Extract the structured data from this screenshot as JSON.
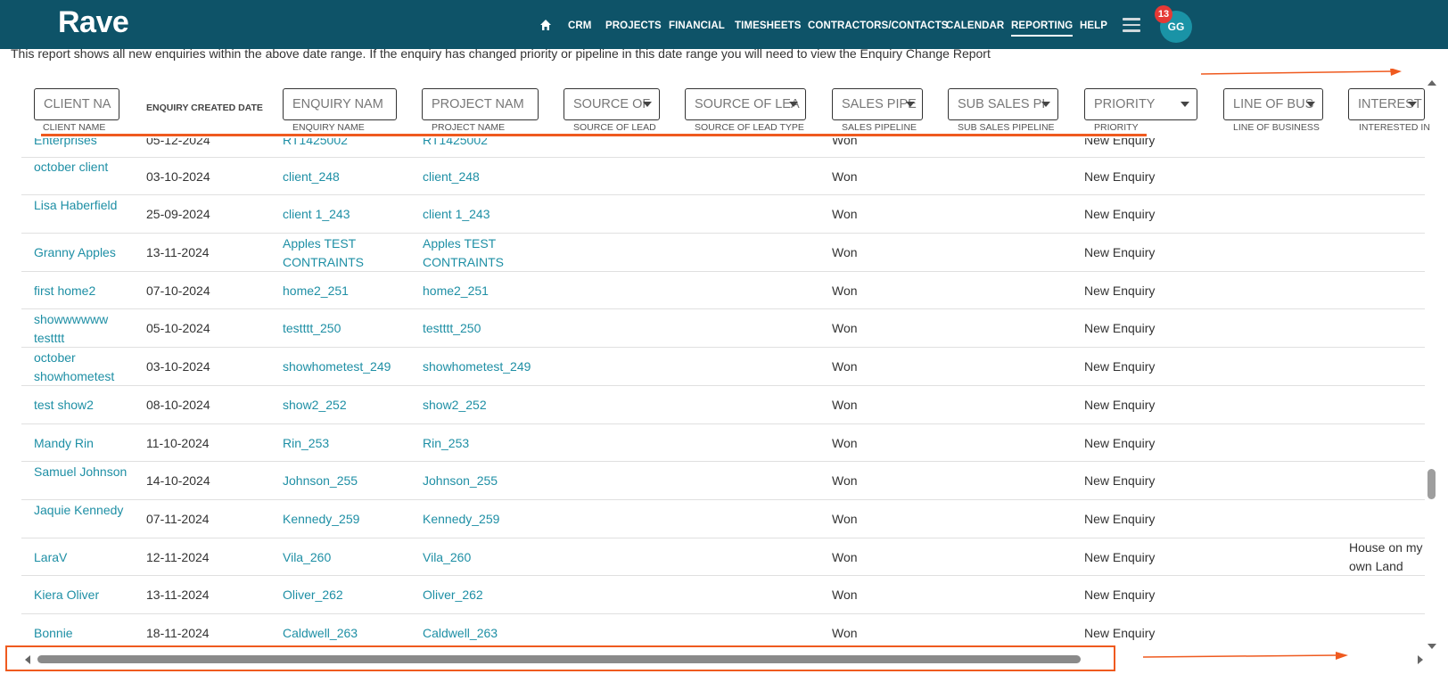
{
  "app": {
    "logo": "Rave"
  },
  "nav": {
    "items": [
      "CRM",
      "PROJECTS",
      "FINANCIAL",
      "TIMESHEETS",
      "CONTRACTORS/CONTACTS",
      "CALENDAR",
      "REPORTING",
      "HELP"
    ],
    "active": "REPORTING",
    "notification_count": "13",
    "avatar_initials": "GG"
  },
  "note": "This report shows all new enquiries within the above date range. If the enquiry has changed priority or pipeline in this date range you will need to view the Enquiry Change Report",
  "filters": [
    {
      "placeholder": "CLIENT NA",
      "label": "CLIENT NAME",
      "dropdown": false
    },
    {
      "placeholder": "ENQUIRY NAM",
      "label": "ENQUIRY NAME",
      "dropdown": false
    },
    {
      "placeholder": "PROJECT NAM",
      "label": "PROJECT NAME",
      "dropdown": false
    },
    {
      "placeholder": "SOURCE OF",
      "label": "SOURCE OF LEAD",
      "dropdown": true
    },
    {
      "placeholder": "SOURCE OF LEA",
      "label": "SOURCE OF LEAD TYPE",
      "dropdown": true
    },
    {
      "placeholder": "SALES PIPE",
      "label": "SALES PIPELINE",
      "dropdown": true
    },
    {
      "placeholder": "SUB SALES PI",
      "label": "SUB SALES PIPELINE",
      "dropdown": true
    },
    {
      "placeholder": "PRIORITY",
      "label": "PRIORITY",
      "dropdown": true
    },
    {
      "placeholder": "LINE OF BUS",
      "label": "LINE OF BUSINESS",
      "dropdown": true
    },
    {
      "placeholder": "INTEREST",
      "label": "INTERESTED IN",
      "dropdown": true
    }
  ],
  "created_date_header": "ENQUIRY CREATED DATE",
  "rows": [
    {
      "client": "Enterprises",
      "date": "05-12-2024",
      "enquiry": "RT1425002",
      "project": "RT1425002",
      "pipeline": "Won",
      "priority": "New Enquiry",
      "interest": ""
    },
    {
      "client": "october client",
      "date": "03-10-2024",
      "enquiry": "client_248",
      "project": "client_248",
      "pipeline": "Won",
      "priority": "New Enquiry",
      "interest": ""
    },
    {
      "client": "Lisa Haberfield",
      "date": "25-09-2024",
      "enquiry": "client 1_243",
      "project": "client 1_243",
      "pipeline": "Won",
      "priority": "New Enquiry",
      "interest": ""
    },
    {
      "client": "Granny Apples",
      "date": "13-11-2024",
      "enquiry": "Apples TEST CONTRAINTS",
      "project": "Apples TEST CONTRAINTS",
      "pipeline": "Won",
      "priority": "New Enquiry",
      "interest": ""
    },
    {
      "client": "first home2",
      "date": "07-10-2024",
      "enquiry": "home2_251",
      "project": "home2_251",
      "pipeline": "Won",
      "priority": "New Enquiry",
      "interest": ""
    },
    {
      "client": "showwwwww testttt",
      "date": "05-10-2024",
      "enquiry": "testttt_250",
      "project": "testttt_250",
      "pipeline": "Won",
      "priority": "New Enquiry",
      "interest": ""
    },
    {
      "client": "october showhometest",
      "date": "03-10-2024",
      "enquiry": "showhometest_249",
      "project": "showhometest_249",
      "pipeline": "Won",
      "priority": "New Enquiry",
      "interest": ""
    },
    {
      "client": "test show2",
      "date": "08-10-2024",
      "enquiry": "show2_252",
      "project": "show2_252",
      "pipeline": "Won",
      "priority": "New Enquiry",
      "interest": ""
    },
    {
      "client": "Mandy Rin",
      "date": "11-10-2024",
      "enquiry": "Rin_253",
      "project": "Rin_253",
      "pipeline": "Won",
      "priority": "New Enquiry",
      "interest": ""
    },
    {
      "client": "Samuel Johnson",
      "date": "14-10-2024",
      "enquiry": "Johnson_255",
      "project": "Johnson_255",
      "pipeline": "Won",
      "priority": "New Enquiry",
      "interest": ""
    },
    {
      "client": "Jaquie Kennedy",
      "date": "07-11-2024",
      "enquiry": "Kennedy_259",
      "project": "Kennedy_259",
      "pipeline": "Won",
      "priority": "New Enquiry",
      "interest": ""
    },
    {
      "client": "LaraV",
      "date": "12-11-2024",
      "enquiry": "Vila_260",
      "project": "Vila_260",
      "pipeline": "Won",
      "priority": "New Enquiry",
      "interest": "House on my own Land"
    },
    {
      "client": "Kiera Oliver",
      "date": "13-11-2024",
      "enquiry": "Oliver_262",
      "project": "Oliver_262",
      "pipeline": "Won",
      "priority": "New Enquiry",
      "interest": ""
    },
    {
      "client": "Bonnie",
      "date": "18-11-2024",
      "enquiry": "Caldwell_263",
      "project": "Caldwell_263",
      "pipeline": "Won",
      "priority": "New Enquiry",
      "interest": ""
    }
  ],
  "colors": {
    "topbar": "#0e5368",
    "link": "#1e8fa5",
    "annotation": "#ef5a1f",
    "badge": "#e53935",
    "avatar": "#1a93a6"
  }
}
